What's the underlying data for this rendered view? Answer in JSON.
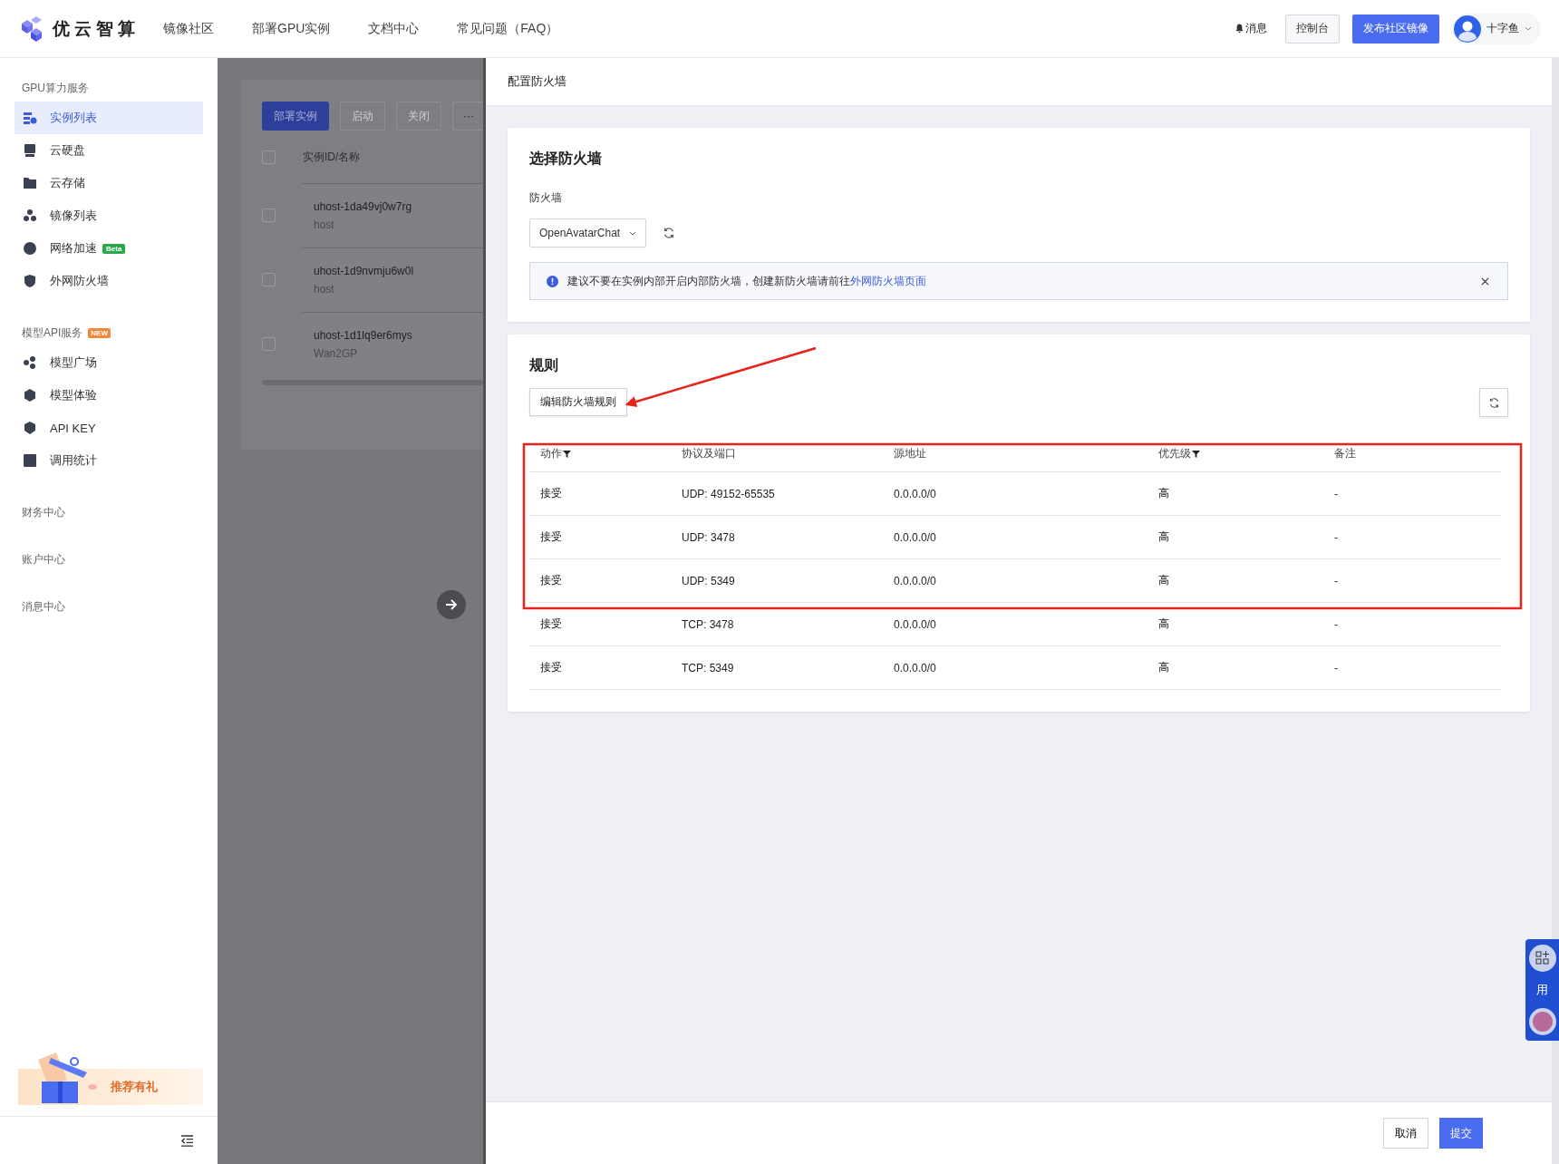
{
  "header": {
    "brand": "优云智算",
    "nav": [
      {
        "label": "镜像社区"
      },
      {
        "label": "部署GPU实例"
      },
      {
        "label": "文档中心"
      },
      {
        "label": "常见问题（FAQ）"
      }
    ],
    "messages": "消息",
    "console": "控制台",
    "publish": "发布社区镜像",
    "user": "十字鱼"
  },
  "sidebar": {
    "sections": [
      {
        "title": "GPU算力服务",
        "items": [
          {
            "label": "实例列表",
            "selected": true
          },
          {
            "label": "云硬盘",
            "selected": false
          },
          {
            "label": "云存储",
            "selected": false
          },
          {
            "label": "镜像列表",
            "selected": false
          },
          {
            "label": "网络加速",
            "selected": false,
            "badge": "Beta"
          },
          {
            "label": "外网防火墙",
            "selected": false
          }
        ]
      },
      {
        "title": "模型API服务",
        "badge": "NEW",
        "items": [
          {
            "label": "模型广场",
            "selected": false
          },
          {
            "label": "模型体验",
            "selected": false
          },
          {
            "label": "API KEY",
            "selected": false
          },
          {
            "label": "调用统计",
            "selected": false
          }
        ]
      },
      {
        "title": "财务中心"
      },
      {
        "title": "账户中心"
      },
      {
        "title": "消息中心"
      }
    ],
    "promo": "推荐有礼"
  },
  "instances": {
    "header_checked": false,
    "buttons": [
      {
        "label": "部署实例",
        "kind": "primary"
      },
      {
        "label": "启动",
        "kind": "disabled"
      },
      {
        "label": "关闭",
        "kind": "disabled"
      },
      {
        "label": "···",
        "kind": "more"
      }
    ],
    "column": "实例ID/名称",
    "rows": [
      {
        "id": "uhost-1da49vj0w7rg",
        "name": "host",
        "checked": false
      },
      {
        "id": "uhost-1d9nvmju6w0l",
        "name": "host",
        "checked": false
      },
      {
        "id": "uhost-1d1lq9er6mys",
        "name": "Wan2GP",
        "checked": false
      }
    ]
  },
  "drawer": {
    "title": "配置防火墙",
    "firewall": {
      "heading": "选择防火墙",
      "label": "防火墙",
      "value": "OpenAvatarChat",
      "notice": "建议不要在实例内部开启内部防火墙，创建新防火墙请前往",
      "link": "外网防火墙页面"
    },
    "rules": {
      "heading": "规则",
      "edit_button": "编辑防火墙规则",
      "columns": [
        {
          "label": "动作",
          "filter": true
        },
        {
          "label": "协议及端口",
          "filter": false
        },
        {
          "label": "源地址",
          "filter": false
        },
        {
          "label": "优先级",
          "filter": true
        },
        {
          "label": "备注",
          "filter": false
        }
      ],
      "rows": [
        {
          "cells": [
            "接受",
            "UDP: 49152-65535",
            "0.0.0.0/0",
            "高",
            "-"
          ]
        },
        {
          "cells": [
            "接受",
            "UDP: 3478",
            "0.0.0.0/0",
            "高",
            "-"
          ]
        },
        {
          "cells": [
            "接受",
            "UDP: 5349",
            "0.0.0.0/0",
            "高",
            "-"
          ]
        },
        {
          "cells": [
            "接受",
            "TCP: 3478",
            "0.0.0.0/0",
            "高",
            "-"
          ]
        },
        {
          "cells": [
            "接受",
            "TCP: 5349",
            "0.0.0.0/0",
            "高",
            "-"
          ]
        }
      ]
    },
    "cancel": "取消",
    "submit": "提交"
  },
  "float_widget": {
    "text": "用"
  }
}
